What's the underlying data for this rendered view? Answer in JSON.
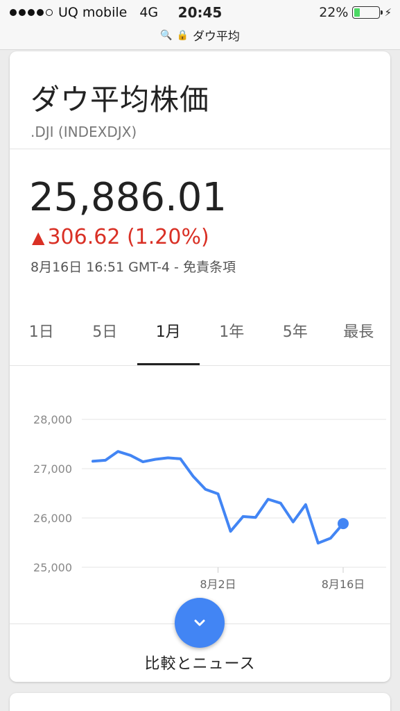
{
  "status_bar": {
    "carrier": "UQ mobile",
    "network": "4G",
    "time": "20:45",
    "battery_percent": "22%",
    "battery_level": 0.22,
    "url": "ダウ平均"
  },
  "header": {
    "title": "ダウ平均株価",
    "ticker": ".DJI (INDEXDJX)"
  },
  "quote": {
    "price": "25,886.01",
    "change": "306.62 (1.20%)",
    "timestamp": "8月16日 16:51 GMT-4 - 免責条項"
  },
  "tabs": [
    {
      "label": "1日"
    },
    {
      "label": "5日"
    },
    {
      "label": "1月"
    },
    {
      "label": "1年"
    },
    {
      "label": "5年"
    },
    {
      "label": "最長"
    }
  ],
  "active_tab": "1月",
  "colors": {
    "line": "#4285f4",
    "change": "#d93025",
    "fab": "#4285f4"
  },
  "chart_data": {
    "type": "line",
    "yticks": [
      "28,000",
      "27,000",
      "26,000",
      "25,000"
    ],
    "ytick_values": [
      28000,
      27000,
      26000,
      25000
    ],
    "ylim": [
      25000,
      28000
    ],
    "xticks": [
      {
        "label": "8月2日",
        "index": 10
      },
      {
        "label": "8月16日",
        "index": 20
      }
    ],
    "values": [
      27150,
      27170,
      27350,
      27270,
      27140,
      27190,
      27220,
      27200,
      26850,
      26580,
      26490,
      25730,
      26030,
      26010,
      26380,
      26300,
      25920,
      26270,
      25490,
      25590,
      25886
    ]
  },
  "compare": {
    "label": "比較とニュース"
  }
}
